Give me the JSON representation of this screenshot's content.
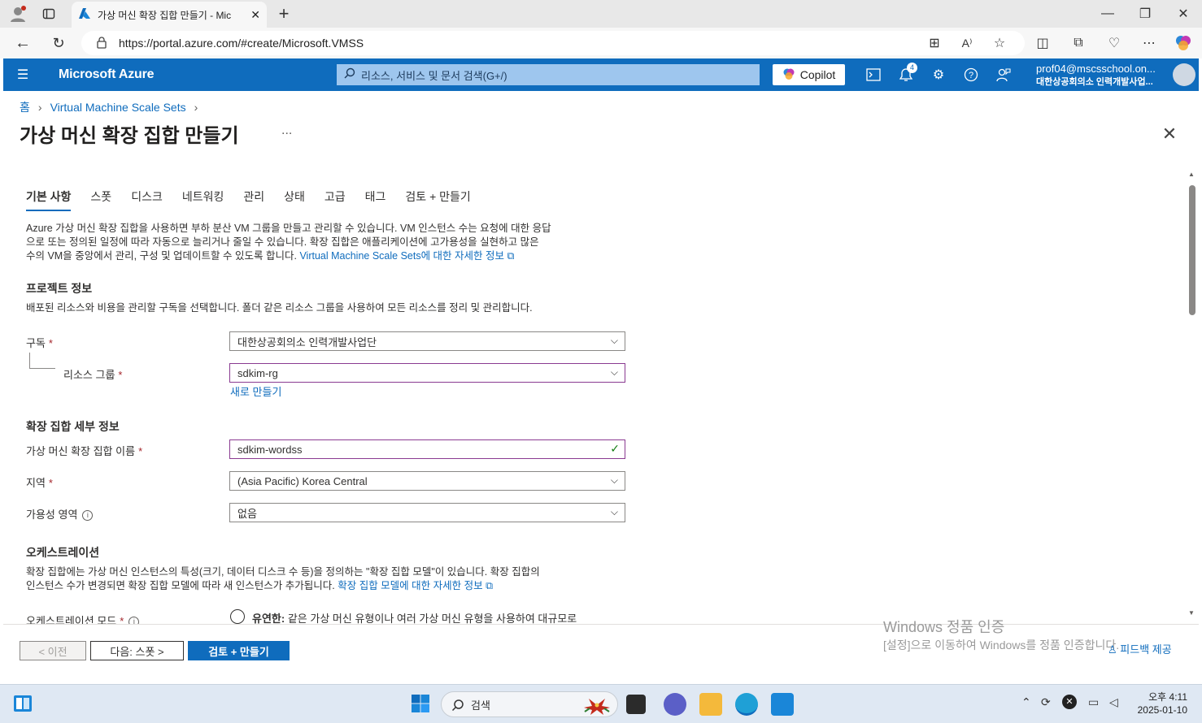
{
  "browser": {
    "tab_title": "가상 머신 확장 집합 만들기 - Mic",
    "url": "https://portal.azure.com/#create/Microsoft.VMSS",
    "new_tab": "+"
  },
  "azure": {
    "brand": "Microsoft Azure",
    "search_placeholder": "리소스, 서비스 및 문서 검색(G+/)",
    "copilot": "Copilot",
    "notif_count": "4",
    "account_email": "prof04@mscsschool.on...",
    "account_org": "대한상공회의소 인력개발사업..."
  },
  "breadcrumb": {
    "home": "홈",
    "parent": "Virtual Machine Scale Sets"
  },
  "page": {
    "title": "가상 머신 확장 집합 만들기",
    "more": "...",
    "close": "✕"
  },
  "tabs": [
    "기본 사항",
    "스폿",
    "디스크",
    "네트워킹",
    "관리",
    "상태",
    "고급",
    "태그",
    "검토 + 만들기"
  ],
  "intro": {
    "line1": "Azure 가상 머신 확장 집합을 사용하면 부하 분산 VM 그룹을 만들고 관리할 수 있습니다. VM 인스턴스 수는 요청에 대한 응답",
    "line2": "으로 또는 정의된 일정에 따라 자동으로 늘리거나 줄일 수 있습니다. 확장 집합은 애플리케이션에 고가용성을 실현하고 많은",
    "line3": "수의 VM을 중앙에서 관리, 구성 및 업데이트할 수 있도록 합니다.",
    "link": "Virtual Machine Scale Sets에 대한 자세한 정보"
  },
  "project": {
    "heading": "프로젝트 정보",
    "desc": "배포된 리소스와 비용을 관리할 구독을 선택합니다. 폴더 같은 리소스 그룹을 사용하여 모든 리소스를 정리 및 관리합니다.",
    "subscription_label": "구독",
    "subscription_value": "대한상공회의소 인력개발사업단",
    "rg_label": "리소스 그룹",
    "rg_value": "sdkim-rg",
    "create_new": "새로 만들기"
  },
  "details": {
    "heading": "확장 집합 세부 정보",
    "name_label": "가상 머신 확장 집합 이름",
    "name_value": "sdkim-wordss",
    "region_label": "지역",
    "region_value": "(Asia Pacific) Korea Central",
    "az_label": "가용성 영역",
    "az_value": "없음"
  },
  "orchestration": {
    "heading": "오케스트레이션",
    "line1": "확장 집합에는 가상 머신 인스턴스의 특성(크기, 데이터 디스크 수 등)을 정의하는 \"확장 집합 모델\"이 있습니다. 확장 집합의",
    "line2": "인스턴스 수가 변경되면 확장 집합 모델에 따라 새 인스턴스가 추가됩니다.",
    "link": "확장 집합 모델에 대한 자세한 정보",
    "mode_label": "오케스트레이션 모드",
    "flex_bold": "유연한:",
    "flex_text": "같은 가상 머신 유형이나 여러 가상 머신 유형을 사용하여 대규모로"
  },
  "required_mark": "*",
  "footer": {
    "prev": "< 이전",
    "next": "다음: 스폿 >",
    "review": "검토 + 만들기",
    "feedback": "피드백 제공"
  },
  "watermark": {
    "line1": "Windows 정품 인증",
    "line2": "[설정]으로 이동하여 Windows를 정품 인증합니다."
  },
  "taskbar": {
    "search": "검색",
    "time": "오후 4:11",
    "date": "2025-01-10"
  }
}
